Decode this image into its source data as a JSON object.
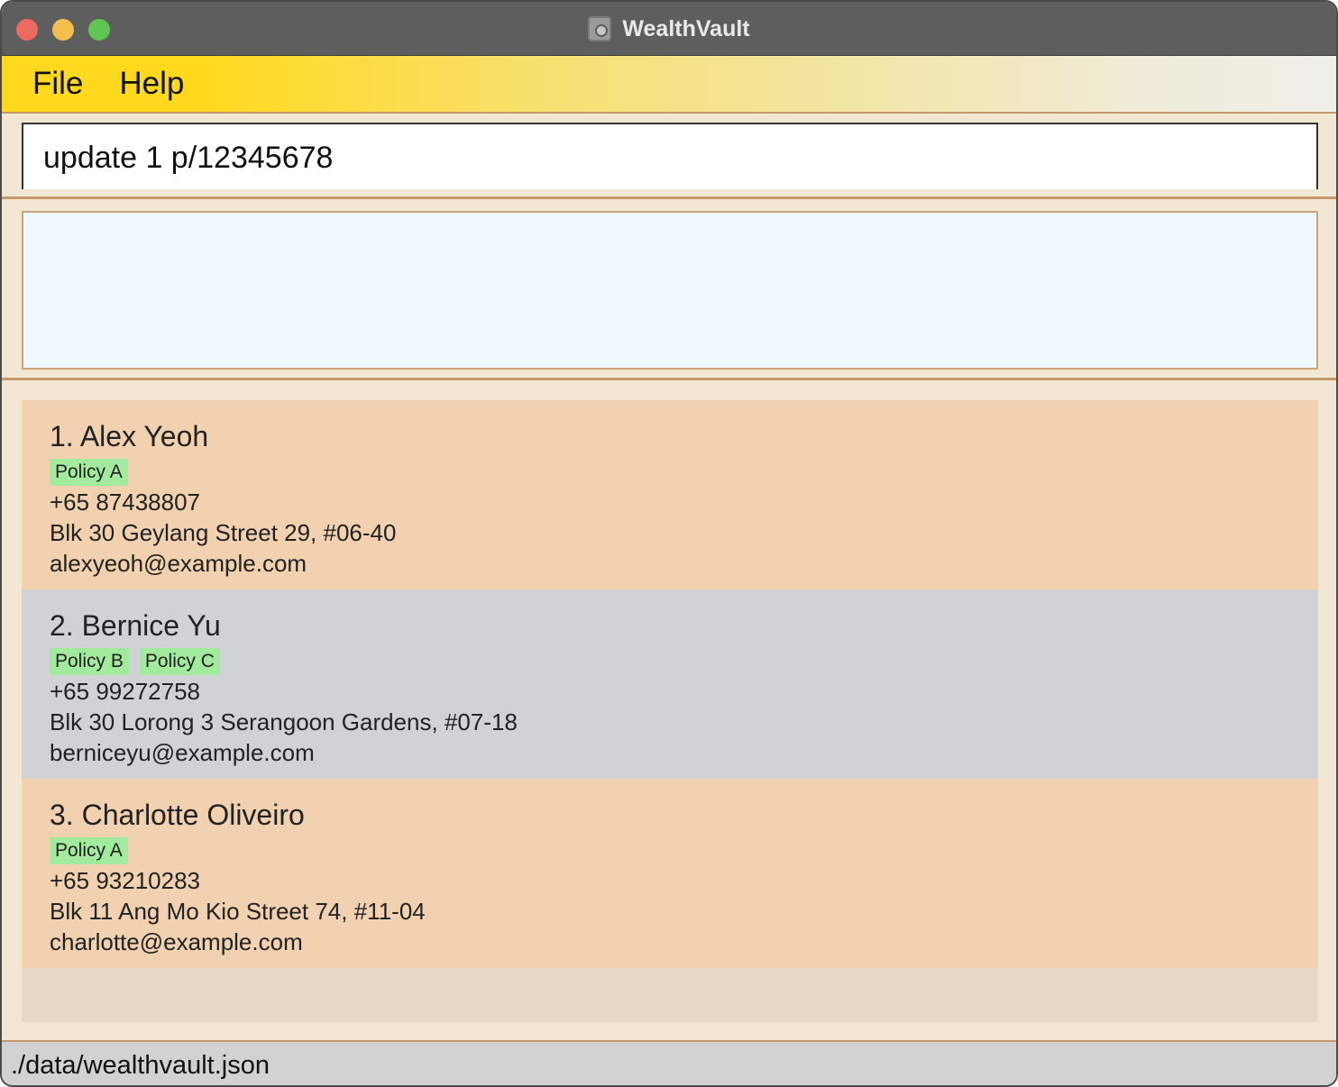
{
  "window": {
    "title": "WealthVault",
    "colors": {
      "menubar_accent": "#ffd91d",
      "card_odd": "#f1d1b0",
      "card_even": "#d1d2d6",
      "tag": "#a2ea9d",
      "result_bg": "#eff9fe"
    }
  },
  "menu": {
    "file": "File",
    "help": "Help"
  },
  "command": {
    "value": "update 1 p/12345678"
  },
  "result": {
    "text": ""
  },
  "persons": [
    {
      "name": "1. Alex Yeoh",
      "tags": [
        "Policy A"
      ],
      "phone": "+65 87438807",
      "address": "Blk 30 Geylang Street 29, #06-40",
      "email": "alexyeoh@example.com"
    },
    {
      "name": "2. Bernice Yu",
      "tags": [
        "Policy B",
        "Policy C"
      ],
      "phone": "+65 99272758",
      "address": "Blk 30 Lorong 3 Serangoon Gardens, #07-18",
      "email": "berniceyu@example.com"
    },
    {
      "name": "3. Charlotte Oliveiro",
      "tags": [
        "Policy A"
      ],
      "phone": "+65 93210283",
      "address": "Blk 11 Ang Mo Kio Street 74, #11-04",
      "email": "charlotte@example.com"
    }
  ],
  "status": {
    "file_path": "./data/wealthvault.json"
  }
}
